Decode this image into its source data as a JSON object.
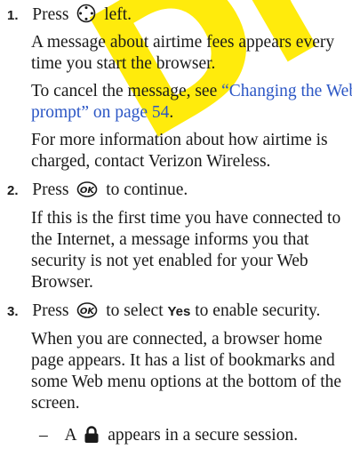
{
  "watermark": {
    "text": "Dr",
    "color": "#ffea00"
  },
  "link_color": "#2b56c5",
  "steps": [
    {
      "number": "1.",
      "press_word": "Press",
      "icon": "navigation-key-icon",
      "action": "left.",
      "paragraphs": [
        [
          "A message about airtime fees appears every",
          "time you start the browser."
        ],
        [
          "To cancel the message, see "
        ],
        [
          "For more information about how airtime is",
          "charged, contact Verizon Wireless."
        ]
      ],
      "link_line_1": "“Changing the Web",
      "link_line_2": "prompt” on page 54",
      "link_suffix": "."
    },
    {
      "number": "2.",
      "press_word": "Press",
      "icon": "ok-key-icon",
      "action": "to continue.",
      "paragraphs": [
        [
          "If this is the first time you have connected to",
          "the Internet, a message informs you that",
          "security is not yet enabled for your Web",
          "Browser."
        ]
      ]
    },
    {
      "number": "3.",
      "press_word": "Press",
      "icon": "ok-key-icon",
      "action_pre": "to select",
      "softkey": "Yes",
      "action_post": "to enable security.",
      "paragraphs": [
        [
          "When you are connected, a browser home",
          "page appears. It has a list of bookmarks and",
          "some Web menu options at the bottom of the",
          "screen."
        ]
      ],
      "bullet": {
        "dash": "–",
        "pre": "A",
        "icon": "lock-icon",
        "post": "appears in a secure session."
      }
    }
  ]
}
